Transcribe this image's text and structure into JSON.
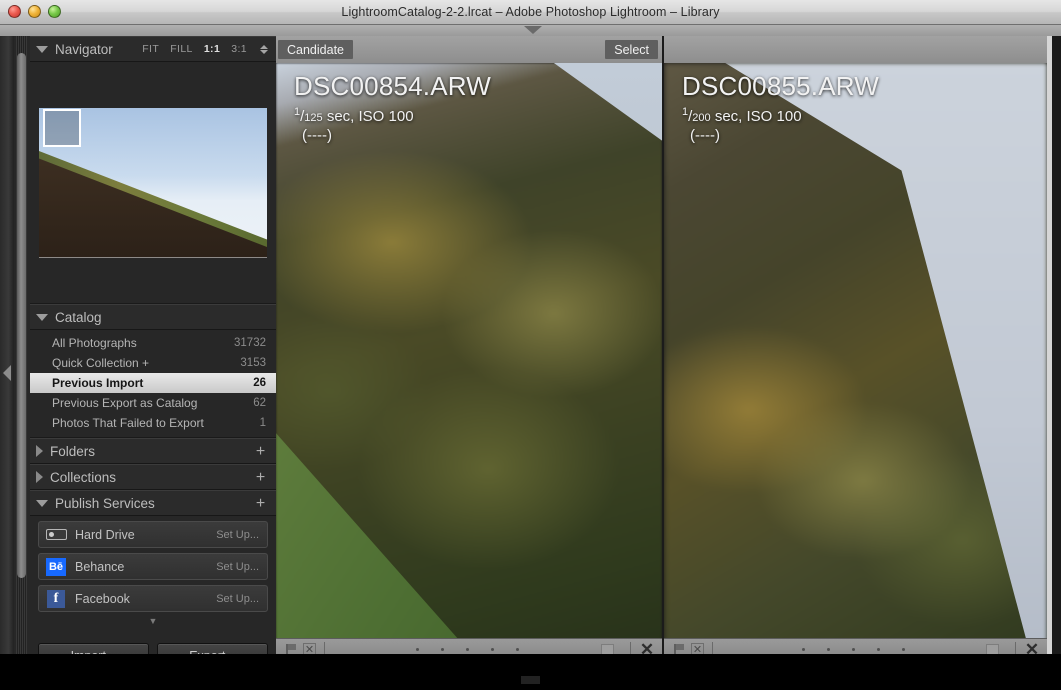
{
  "window": {
    "title": "LightroomCatalog-2-2.lrcat – Adobe Photoshop Lightroom – Library",
    "traffic_lights": [
      "close-button",
      "minimize-button",
      "zoom-button"
    ]
  },
  "sidebar": {
    "navigator": {
      "title": "Navigator",
      "zoom_levels": [
        {
          "label": "FIT",
          "active": false
        },
        {
          "label": "FILL",
          "active": false
        },
        {
          "label": "1:1",
          "active": true
        },
        {
          "label": "3:1",
          "active": false
        }
      ]
    },
    "catalog": {
      "title": "Catalog",
      "items": [
        {
          "label": "All Photographs",
          "count": "31732",
          "selected": false
        },
        {
          "label": "Quick Collection  +",
          "count": "3153",
          "selected": false
        },
        {
          "label": "Previous Import",
          "count": "26",
          "selected": true
        },
        {
          "label": "Previous Export as Catalog",
          "count": "62",
          "selected": false
        },
        {
          "label": "Photos That Failed to Export",
          "count": "1",
          "selected": false
        }
      ]
    },
    "folders": {
      "title": "Folders",
      "expanded": false
    },
    "collections": {
      "title": "Collections",
      "expanded": false
    },
    "publish_services": {
      "title": "Publish Services",
      "expanded": true,
      "items": [
        {
          "label": "Hard Drive",
          "action": "Set Up...",
          "icon": "hard-drive-icon"
        },
        {
          "label": "Behance",
          "action": "Set Up...",
          "icon": "behance-icon",
          "glyph": "Bē"
        },
        {
          "label": "Facebook",
          "action": "Set Up...",
          "icon": "facebook-icon",
          "glyph": "f"
        }
      ]
    },
    "buttons": {
      "import": "Import...",
      "export": "Export..."
    }
  },
  "compare": {
    "select_badge": "Select",
    "candidate_badge": "Candidate",
    "panes": [
      {
        "role": "select",
        "filename": "DSC00854.ARW",
        "shutter_num": "1",
        "shutter_den": "125",
        "exif_tail": " sec, ISO 100",
        "dashes": "(----)"
      },
      {
        "role": "candidate",
        "filename": "DSC00855.ARW",
        "shutter_num": "1",
        "shutter_den": "200",
        "exif_tail": " sec, ISO 100",
        "dashes": "(----)"
      }
    ],
    "toolbar": {
      "flag_icon": "flag-icon",
      "reject_icon": "reject-icon",
      "reject_glyph": "✕",
      "rating_dots": 5,
      "color_swatch": "color-label-swatch",
      "close_glyph": "✕"
    }
  },
  "colors": {
    "panel_bg": "#272727",
    "selection": "#e9e9e9",
    "badge_bg": "#5f5f5f",
    "behance_blue": "#1769ff",
    "facebook_blue": "#3b5998"
  }
}
